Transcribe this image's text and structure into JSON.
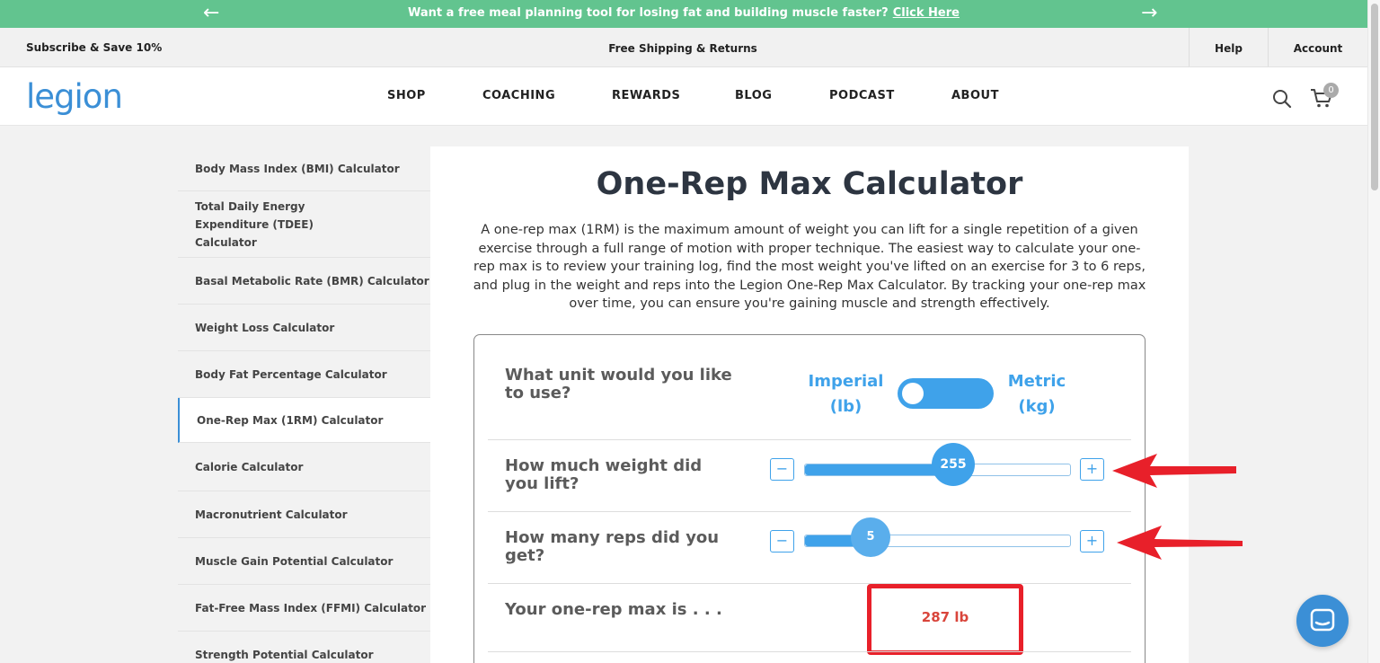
{
  "promo": {
    "message": "Want a free meal planning tool for losing fat and building muscle faster?",
    "link": "Click Here",
    "prev_icon": "arrow-left-icon",
    "next_icon": "arrow-right-icon"
  },
  "utility": {
    "subscribe": "Subscribe & Save 10%",
    "shipping": "Free Shipping & Returns",
    "help": "Help",
    "account": "Account"
  },
  "header": {
    "logo": "legion",
    "nav": [
      "SHOP",
      "COACHING",
      "REWARDS",
      "BLOG",
      "PODCAST",
      "ABOUT"
    ],
    "cart_count": "0",
    "search_icon": "search-icon",
    "cart_icon": "cart-icon"
  },
  "sidebar": {
    "items": [
      "Body Mass Index (BMI) Calculator",
      "Total Daily Energy Expenditure (TDEE) Calculator",
      "Basal Metabolic Rate (BMR) Calculator",
      "Weight Loss Calculator",
      "Body Fat Percentage Calculator",
      "One-Rep Max (1RM) Calculator",
      "Calorie Calculator",
      "Macronutrient Calculator",
      "Muscle Gain Potential Calculator",
      "Fat-Free Mass Index (FFMI) Calculator",
      "Strength Potential Calculator"
    ],
    "active_index": 5
  },
  "main": {
    "title": "One-Rep Max Calculator",
    "intro": "A one-rep max (1RM) is the maximum amount of weight you can lift for a single repetition of a given exercise through a full range of motion with proper technique. The easiest way to calculate your one-rep max is to review your training log, find the most weight you've lifted on an exercise for 3 to 6 reps, and plug in the weight and reps into the Legion One-Rep Max Calculator. By tracking your one-rep max over time, you can ensure you're gaining muscle and strength effectively."
  },
  "calculator": {
    "unit_question": "What unit would you like to use?",
    "imperial_label": "Imperial",
    "imperial_unit": "(lb)",
    "metric_label": "Metric",
    "metric_unit": "(kg)",
    "unit_selected": "Imperial",
    "weight_question": "How much weight did you lift?",
    "weight_value": "255",
    "weight_fill_fraction": 0.56,
    "reps_question": "How many reps did you get?",
    "reps_value": "5",
    "reps_fill_fraction": 0.25,
    "minus_label": "−",
    "plus_label": "+",
    "result_question": "Your one-rep max is . . .",
    "result_value": "287 lb"
  },
  "colors": {
    "promo_green": "#62c48f",
    "brand_blue": "#3b8fd6",
    "accent_blue": "#3fa2ea",
    "highlight_red": "#e8202a"
  }
}
